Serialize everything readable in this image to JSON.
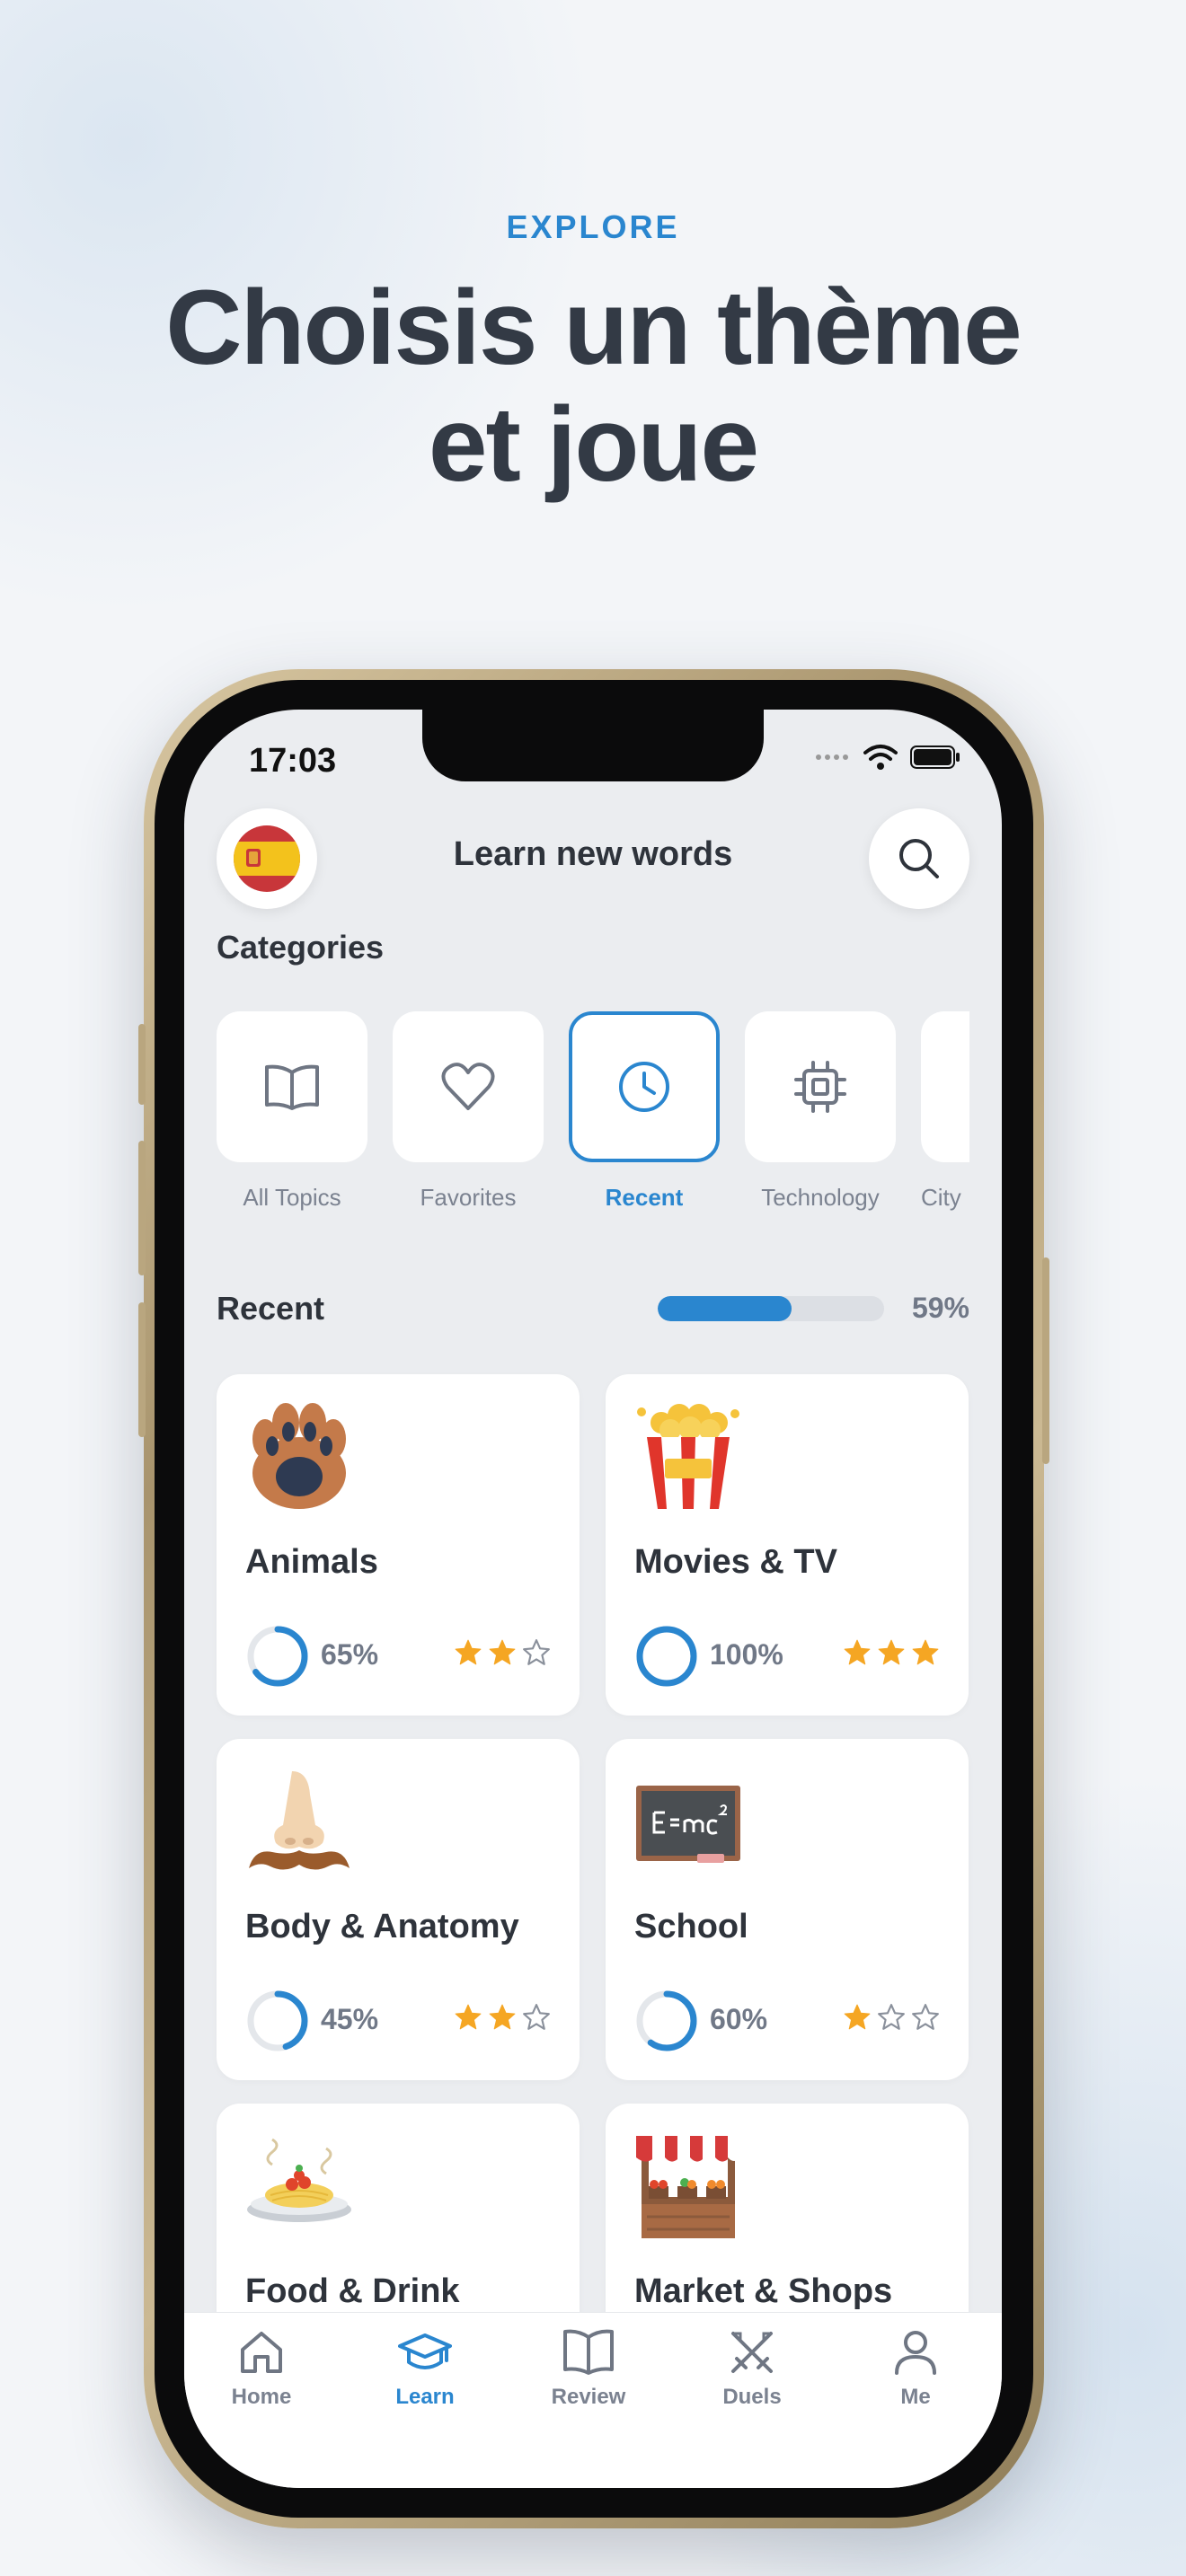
{
  "promo": {
    "eyebrow": "EXPLORE",
    "title_line1": "Choisis un thème",
    "title_line2": "et joue"
  },
  "status_bar": {
    "time": "17:03"
  },
  "header": {
    "title": "Learn new words",
    "flag_icon": "spain-flag-icon",
    "search_icon": "search-icon"
  },
  "categories": {
    "title": "Categories",
    "items": [
      {
        "label": "All Topics",
        "icon": "book-icon",
        "active": false
      },
      {
        "label": "Favorites",
        "icon": "heart-icon",
        "active": false
      },
      {
        "label": "Recent",
        "icon": "clock-icon",
        "active": true
      },
      {
        "label": "Technology",
        "icon": "chip-icon",
        "active": false
      },
      {
        "label": "City",
        "icon": "city-icon",
        "active": false
      }
    ]
  },
  "recent": {
    "title": "Recent",
    "progress_label": "59%",
    "progress_value": 0.59
  },
  "topics": [
    {
      "title": "Animals",
      "icon": "paw-icon",
      "percent_label": "65%",
      "percent": 65,
      "stars": 2
    },
    {
      "title": "Movies & TV",
      "icon": "popcorn-icon",
      "percent_label": "100%",
      "percent": 100,
      "stars": 3
    },
    {
      "title": "Body & Anatomy",
      "icon": "nose-mustache-icon",
      "percent_label": "45%",
      "percent": 45,
      "stars": 2
    },
    {
      "title": "School",
      "icon": "chalkboard-icon",
      "percent_label": "60%",
      "percent": 60,
      "stars": 1
    },
    {
      "title": "Food & Drink",
      "icon": "pasta-plate-icon"
    },
    {
      "title": "Market & Shops",
      "icon": "market-stall-icon"
    }
  ],
  "tabbar": {
    "items": [
      {
        "label": "Home",
        "icon": "home-icon",
        "active": false
      },
      {
        "label": "Learn",
        "icon": "graduation-cap-icon",
        "active": true
      },
      {
        "label": "Review",
        "icon": "open-book-icon",
        "active": false
      },
      {
        "label": "Duels",
        "icon": "crossed-swords-icon",
        "active": false
      },
      {
        "label": "Me",
        "icon": "user-icon",
        "active": false
      }
    ]
  },
  "colors": {
    "accent": "#2a86cf",
    "star": "#f5a623",
    "title": "#333a45",
    "muted": "#707887"
  }
}
